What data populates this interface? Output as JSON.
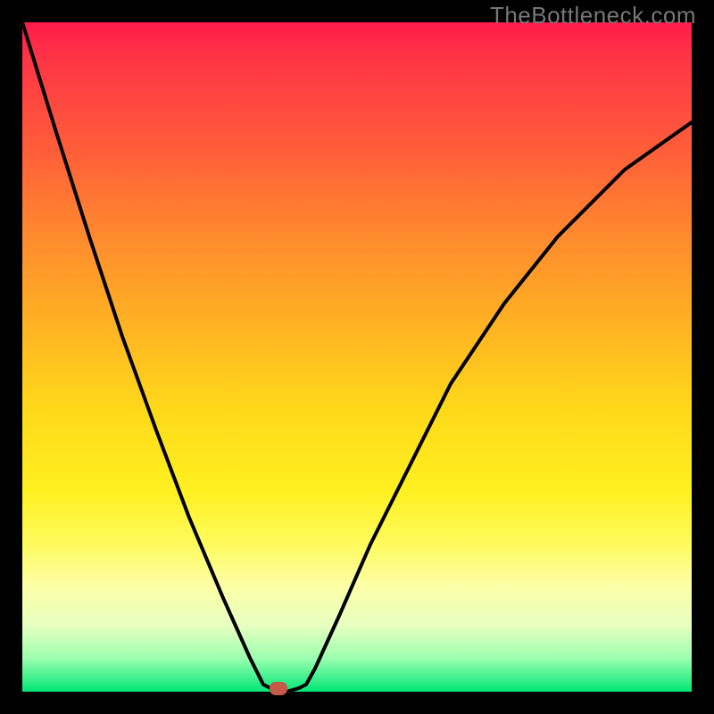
{
  "watermark": "TheBottleneck.com",
  "colors": {
    "gradient_top": "#ff1a4a",
    "gradient_bottom": "#00e676",
    "curve": "#000000",
    "marker": "#c55a4a",
    "frame": "#000000"
  },
  "chart_data": {
    "type": "line",
    "title": "",
    "xlabel": "",
    "ylabel": "",
    "xlim": [
      0,
      100
    ],
    "ylim": [
      0,
      100
    ],
    "annotations": [
      {
        "name": "marker",
        "x": 39,
        "y": 0
      }
    ],
    "series": [
      {
        "name": "bottleneck-curve",
        "x": [
          0,
          5,
          10,
          15,
          20,
          25,
          30,
          34,
          36,
          38,
          40,
          42,
          44,
          48,
          52,
          58,
          64,
          72,
          80,
          90,
          100
        ],
        "y": [
          100,
          84,
          68,
          53,
          39,
          26,
          14,
          5,
          1,
          0,
          0,
          1,
          4,
          12,
          22,
          34,
          46,
          58,
          68,
          78,
          85
        ]
      }
    ]
  }
}
